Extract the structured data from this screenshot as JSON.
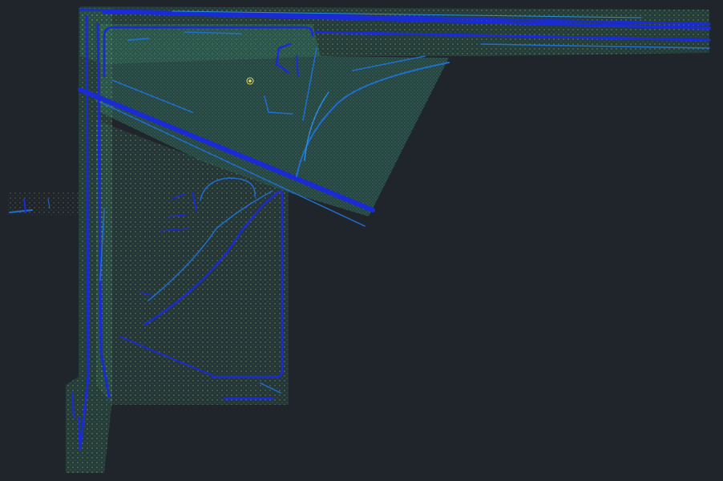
{
  "map": {
    "background_color": "#20252c",
    "point_cloud_color": "#2f6b5a",
    "point_dot_color": "#c9c86a",
    "highlight_point_color": "#e0e060",
    "primary_line_color": "#1a2bd6",
    "secondary_line_color": "#1f6fd0",
    "thin_line_color": "#2a8be0"
  }
}
